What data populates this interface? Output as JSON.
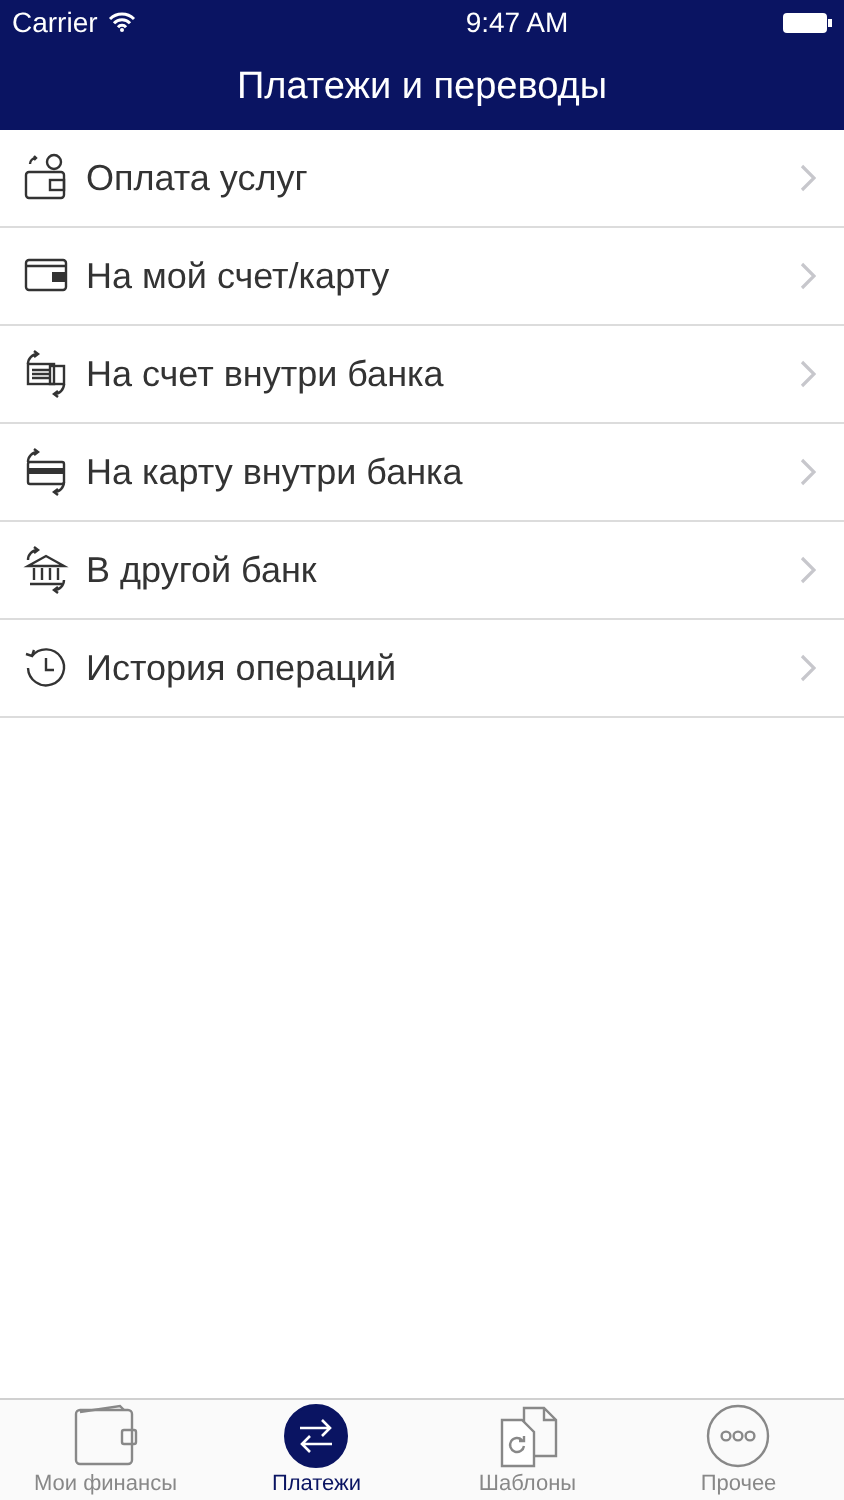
{
  "status_bar": {
    "carrier": "Carrier",
    "time": "9:47 AM"
  },
  "nav_bar": {
    "title": "Платежи и переводы"
  },
  "menu": [
    {
      "kind": "bill",
      "label": "Оплата услуг"
    },
    {
      "kind": "wallet",
      "label": "На мой счет/карту"
    },
    {
      "kind": "account",
      "label": "На счет внутри банка"
    },
    {
      "kind": "card",
      "label": "На карту внутри банка"
    },
    {
      "kind": "bank",
      "label": "В другой банк"
    },
    {
      "kind": "history",
      "label": "История операций"
    }
  ],
  "tab_bar": [
    {
      "kind": "wallet",
      "label": "Мои финансы",
      "selected": false
    },
    {
      "kind": "transfer",
      "label": "Платежи",
      "selected": true
    },
    {
      "kind": "templates",
      "label": "Шаблоны",
      "selected": false
    },
    {
      "kind": "more",
      "label": "Прочее",
      "selected": false
    }
  ]
}
